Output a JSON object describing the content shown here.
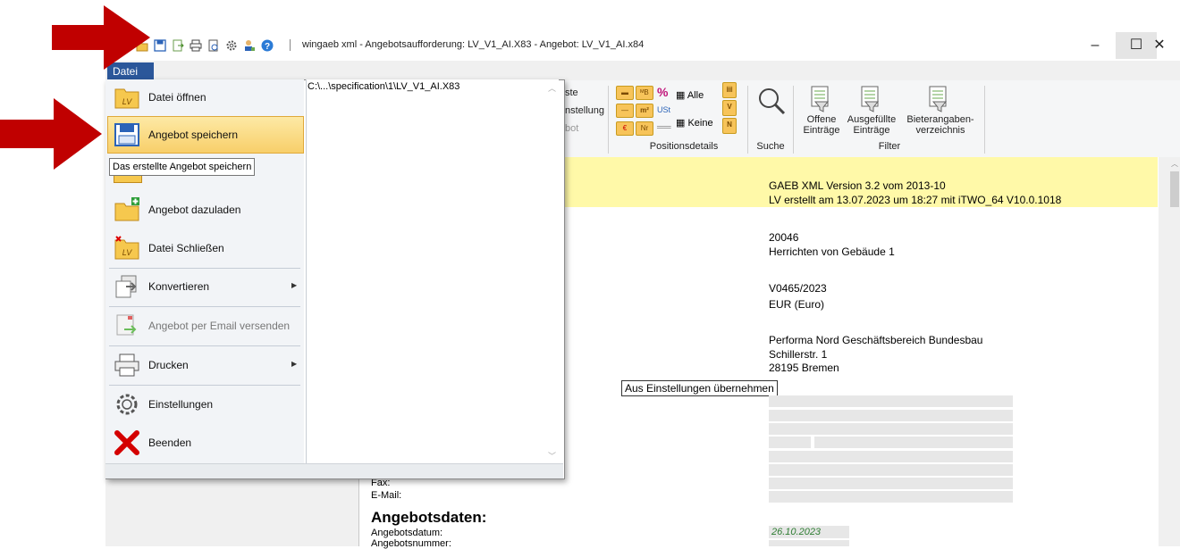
{
  "window": {
    "title": "wingaeb xml - Angebotsaufforderung: LV_V1_AI.X83 - Angebot: LV_V1_AI.x84",
    "minimize": "–",
    "maximize": "☐",
    "close": "✕"
  },
  "menu_tab": "Datei",
  "ribbon": {
    "partial_labels": [
      "ste",
      "nstellung",
      "bot"
    ],
    "alle": "Alle",
    "keine": "Keine",
    "ust": "USt",
    "group_positionsdetails": "Positionsdetails",
    "group_suche": "Suche",
    "group_filter": "Filter",
    "offene_line1": "Offene",
    "offene_line2": "Einträge",
    "ausgefuellte_line1": "Ausgefüllte",
    "ausgefuellte_line2": "Einträge",
    "bieter_line1": "Bieterangaben-",
    "bieter_line2": "verzeichnis"
  },
  "menu": {
    "items": [
      {
        "label": "Datei öffnen",
        "icon": "folder-lv-icon"
      },
      {
        "label": "Angebot speichern",
        "icon": "save-icon"
      },
      {
        "label": "Angebot dazuladen",
        "icon": "folder-add-icon"
      },
      {
        "label": "Datei Schließen",
        "icon": "folder-close-icon"
      },
      {
        "label": "Konvertieren",
        "icon": "convert-icon"
      },
      {
        "label": "Angebot per Email versenden",
        "icon": "email-icon"
      },
      {
        "label": "Drucken",
        "icon": "printer-icon"
      },
      {
        "label": "Einstellungen",
        "icon": "gear-icon"
      },
      {
        "label": "Beenden",
        "icon": "exit-x-icon"
      }
    ],
    "tooltip": "Das erstellte Angebot speichern",
    "recent_file": "C:\\...\\specification\\1\\LV_V1_AI.X83"
  },
  "document": {
    "gaeb_version": "GAEB XML Version 3.2 vom 2013-10",
    "lv_created": "LV erstellt am 13.07.2023 um 18:27 mit iTWO_64 V10.0.1018",
    "project_number": "20046",
    "project_name": "Herrichten von Gebäude 1",
    "lv_number": "V0465/2023",
    "currency": "EUR (Euro)",
    "client_line1": "Performa Nord Geschäftsbereich Bundesbau",
    "client_line2": "Schillerstr. 1",
    "client_line3": "28195 Bremen",
    "button_from_settings": "Aus Einstellungen übernehmen",
    "fax_label": "Fax:",
    "email_label": "E-Mail:",
    "section_heading": "Angebotsdaten:",
    "offer_date_label": "Angebotsdatum:",
    "offer_number_label": "Angebotsnummer:",
    "offer_date_value": "26.10.2023"
  },
  "colors": {
    "datei_tab": "#2b579a",
    "highlight": "#f8cf6a",
    "yellow_band": "#fff9a8",
    "red_arrow": "#c00000",
    "date_green": "#2e7d32"
  }
}
